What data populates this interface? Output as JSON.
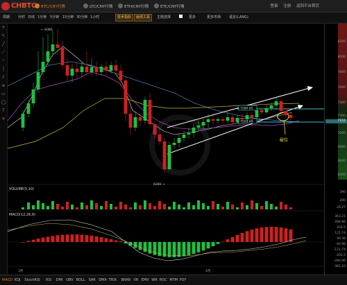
{
  "brand": {
    "name": "CHBTC"
  },
  "market_tabs": [
    {
      "label": "BTC/CNY行情",
      "active": true
    },
    {
      "label": "LTC/CNY行情",
      "active": false
    },
    {
      "label": "ETH/CNY行情",
      "active": false
    },
    {
      "label": "ETC/CNY行情",
      "active": false
    }
  ],
  "top_links": [
    "登录",
    "注册",
    "返回平台首页"
  ],
  "toolbar": {
    "period_label": "周期",
    "periods": [
      "分时",
      "日线",
      "1分钟",
      "5分钟",
      "15分钟",
      "30分钟",
      "1小时"
    ],
    "tech_btn": "技术指标",
    "draw_btn": "画线工具",
    "theme_label": "主题选择",
    "more_label": "更多",
    "settings_label": "更多市场",
    "lang_label": "语言(LANG)"
  },
  "main_chart": {
    "high_label": "← 8380",
    "low_label": "6280 →",
    "box_upper": "7280.65",
    "box_lower": "7163.48",
    "annotation": "破位",
    "y_labels": [
      "8200",
      "8000",
      "7800",
      "7600",
      "7400",
      "7200",
      "7000",
      "6800",
      "6600",
      "6400"
    ],
    "current_price": "7151"
  },
  "volume_panel": {
    "title": "VOLUME(5,10)",
    "y_labels": [
      "390",
      "200",
      "26.27"
    ]
  },
  "macd_panel": {
    "title": "MACD(12,26,9)",
    "y_labels": [
      "363.21",
      "284.86",
      "202.5",
      "121.74",
      "40.38",
      "-40.98",
      "-121.74",
      "-202.5",
      "-284.06",
      "-365.43"
    ]
  },
  "x_labels": [
    "3月",
    "4月"
  ],
  "indicators": [
    "MACD",
    "KDJ",
    "StochRSI",
    "RSI",
    "DMI",
    "OBV",
    "BOLL",
    "SAR",
    "DMA",
    "TRIX",
    "BRAR",
    "VR",
    "EMV",
    "WR",
    "ROC",
    "MTM",
    "PSY"
  ],
  "colors": {
    "up": "#20c040",
    "down": "#d02020",
    "accent": "#e0781c"
  }
}
